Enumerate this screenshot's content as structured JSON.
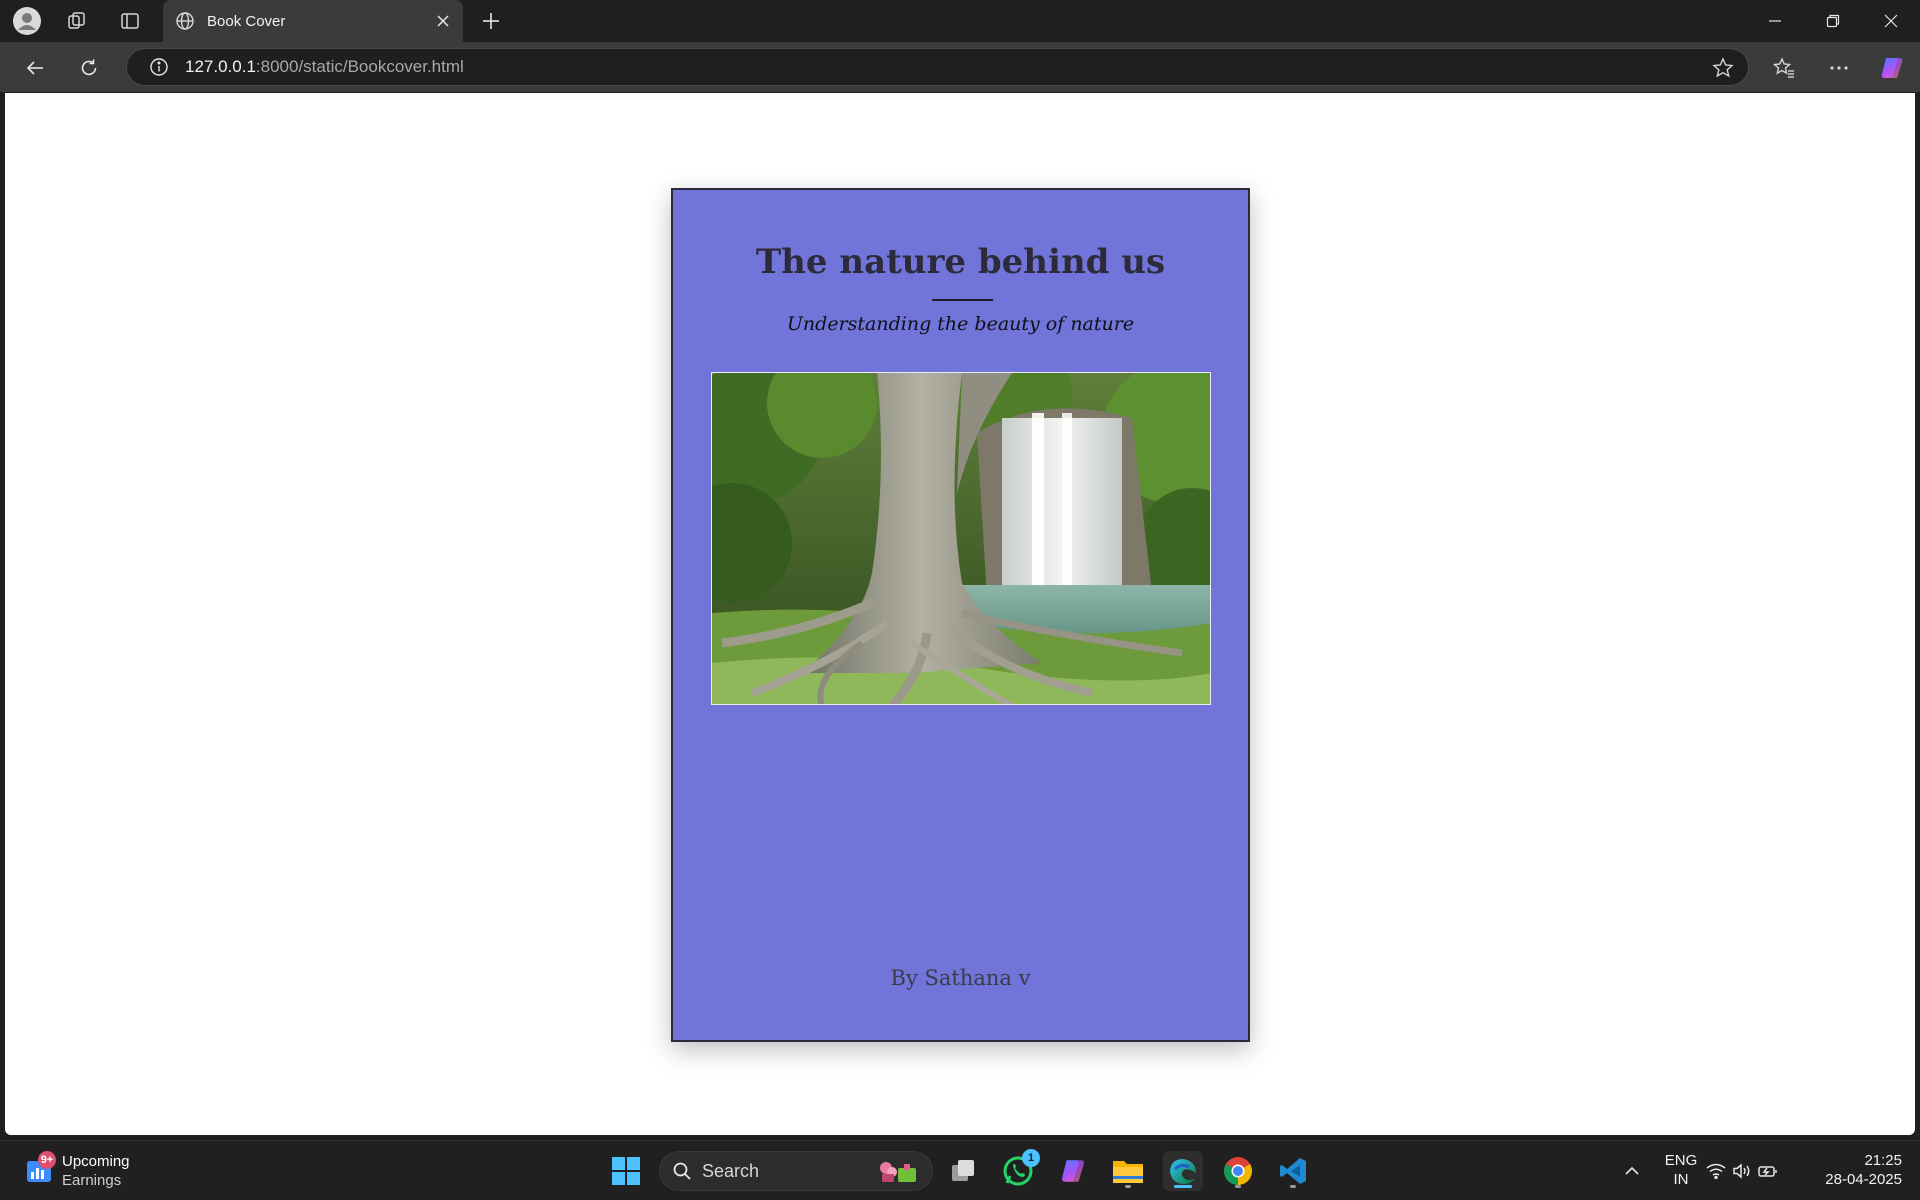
{
  "browser": {
    "tab_title": "Book Cover",
    "url_host": "127.0.0.1",
    "url_path": ":8000/static/Bookcover.html"
  },
  "book": {
    "title": "The nature behind us",
    "subtitle": "Understanding the beauty of nature",
    "author": "By Sathana v",
    "background_color": "#7174d9",
    "image_description": "tree roots and waterfall"
  },
  "taskbar": {
    "weather_title": "Upcoming",
    "weather_subtitle": "Earnings",
    "weather_badge": "9+",
    "search_label": "Search",
    "whatsapp_badge": "1",
    "lang_line1": "ENG",
    "lang_line2": "IN",
    "time": "21:25",
    "date": "28-04-2025"
  },
  "colors": {
    "accent": "#4cc2ff",
    "chrome_dark": "#1f1f1f",
    "chrome_mid": "#3b3b3b"
  }
}
